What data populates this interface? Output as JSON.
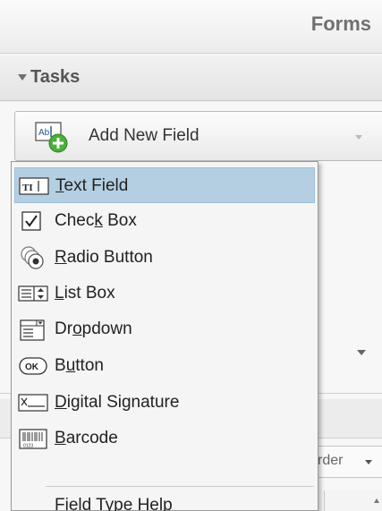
{
  "panel": {
    "title": "Forms",
    "tasks_label": "Tasks"
  },
  "toolbar": {
    "add_field_label": "Add New Field"
  },
  "background": {
    "order_label": "rder"
  },
  "menu": {
    "items": [
      {
        "before": "",
        "mnemonic": "T",
        "after": "ext Field",
        "icon": "text-field-icon"
      },
      {
        "before": "Chec",
        "mnemonic": "k",
        "after": " Box",
        "icon": "check-box-icon"
      },
      {
        "before": "",
        "mnemonic": "R",
        "after": "adio Button",
        "icon": "radio-button-icon"
      },
      {
        "before": "",
        "mnemonic": "L",
        "after": "ist Box",
        "icon": "list-box-icon"
      },
      {
        "before": "Dr",
        "mnemonic": "o",
        "after": "pdown",
        "icon": "dropdown-icon"
      },
      {
        "before": "B",
        "mnemonic": "u",
        "after": "tton",
        "icon": "button-icon"
      },
      {
        "before": "",
        "mnemonic": "D",
        "after": "igital Signature",
        "icon": "digital-signature-icon"
      },
      {
        "before": "",
        "mnemonic": "B",
        "after": "arcode",
        "icon": "barcode-icon"
      }
    ],
    "help_label": "Field Type Help",
    "selected_index": 0
  },
  "colors": {
    "selected_bg": "#b5cfe2",
    "menu_bg": "#f5f5f5",
    "header_text": "#707070"
  }
}
